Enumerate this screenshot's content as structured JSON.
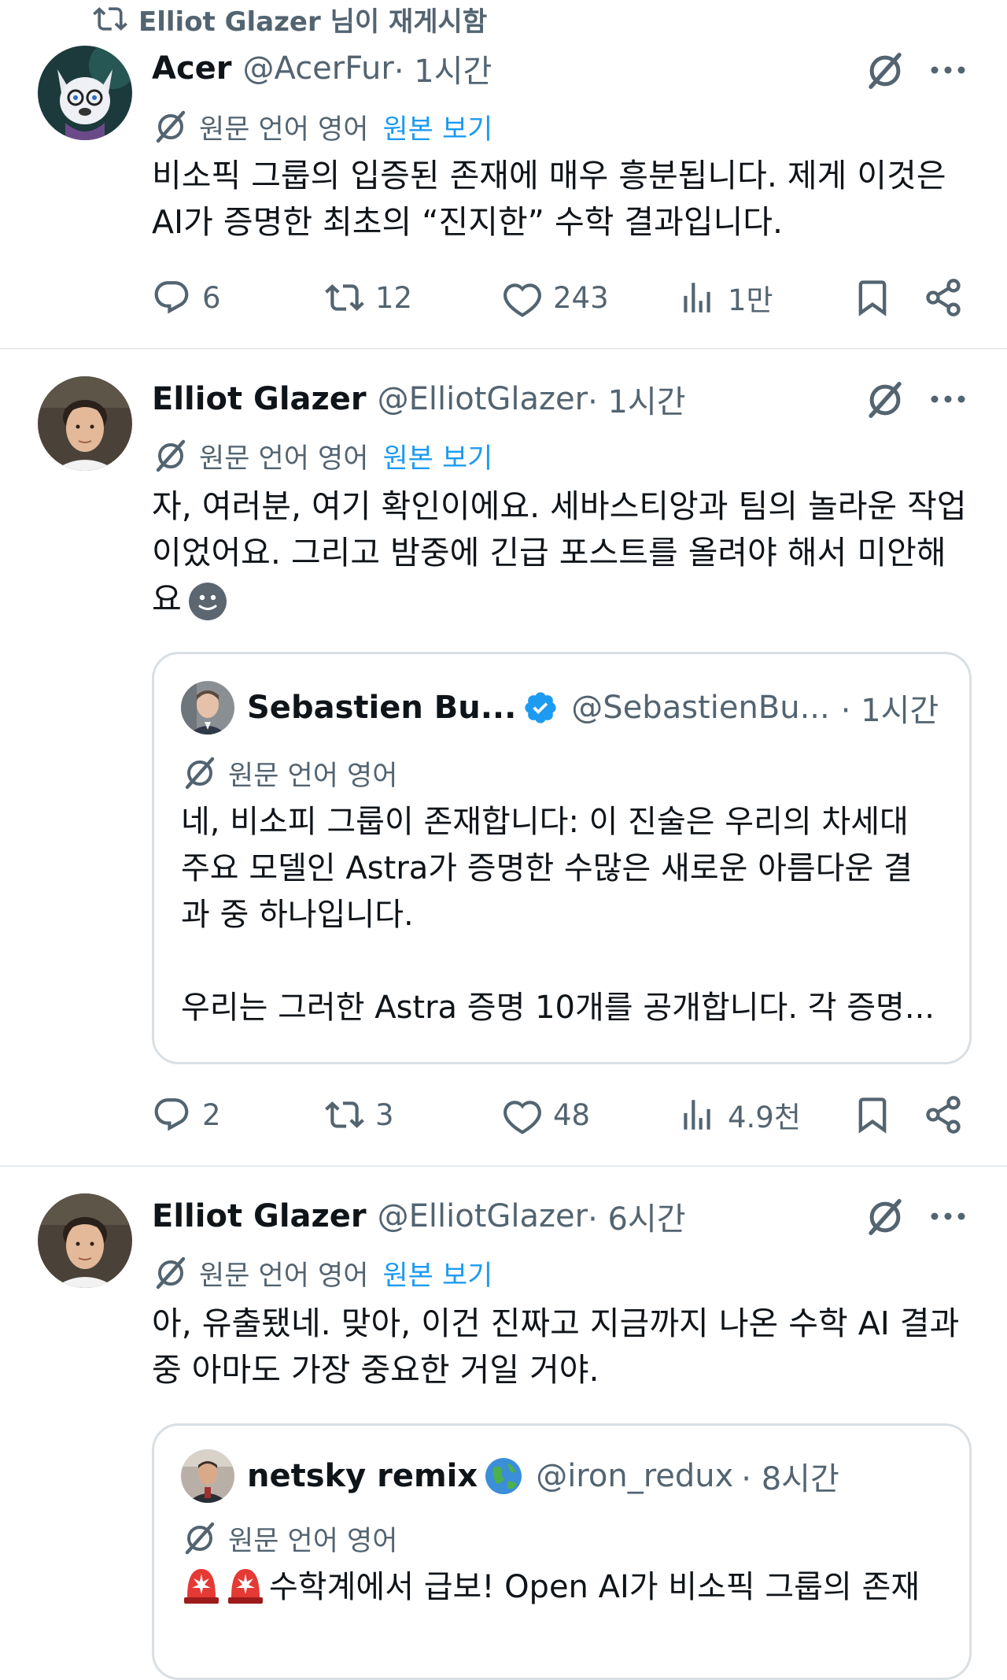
{
  "repost_banner": {
    "text": "Elliot Glazer 님이 재게시함"
  },
  "posts": [
    {
      "name": "Acer",
      "handle": "@AcerFur",
      "time": " · 1시간",
      "translation_label": "원문 언어 영어",
      "view_original": "원본 보기",
      "body_lines": [
        "비소픽 그룹의 입증된 존재에 매우 흥분됩니다. 제게 이것은",
        "AI가 증명한 최초의 “진지한” 수학 결과입니다."
      ],
      "replies": "6",
      "reposts": "12",
      "likes": "243",
      "views": "1만"
    },
    {
      "name": "Elliot Glazer",
      "handle": "@ElliotGlazer",
      "time": " · 1시간",
      "translation_label": "원문 언어 영어",
      "view_original": "원본 보기",
      "body_lines": [
        "자, 여러분, 여기 확인이에요. 세바스티앙과 팀의 놀라운 작업",
        "이었어요. 그리고 밤중에 긴급 포스트를 올려야 해서 미안해",
        "요"
      ],
      "quote": {
        "name": "Sebastien Bu...",
        "handle": "@SebastienBu...",
        "time": " · 1시간",
        "translation_label": "원문 언어 영어",
        "lines": [
          "네, 비소피 그룹이 존재합니다: 이 진술은 우리의 차세대",
          "주요 모델인 Astra가 증명한 수많은 새로운 아름다운 결",
          "과 중 하나입니다.",
          "우리는 그러한 Astra 증명 10개를 공개합니다. 각 증명..."
        ]
      },
      "replies": "2",
      "reposts": "3",
      "likes": "48",
      "views": "4.9천"
    },
    {
      "name": "Elliot Glazer",
      "handle": "@ElliotGlazer",
      "time": " · 6시간",
      "translation_label": "원문 언어 영어",
      "view_original": "원본 보기",
      "body_lines": [
        "아, 유출됐네. 맞아, 이건 진짜고 지금까지 나온 수학 AI 결과",
        "중 아마도 가장 중요한 거일 거야."
      ],
      "quote": {
        "name": "netsky remix",
        "handle": "@iron_redux",
        "time": " · 8시간",
        "translation_label": "원문 언어 영어",
        "lines": [
          "수학계에서 급보! Open AI가 비소픽 그룹의 존재"
        ]
      }
    }
  ],
  "colors": {
    "accent": "#1d9bf0",
    "muted": "#536471",
    "text": "#0f1419",
    "border": "#d9dfe3"
  },
  "icons": [
    "repost-icon",
    "grok-translate-icon",
    "more-icon",
    "reply-icon",
    "like-icon",
    "views-icon",
    "bookmark-icon",
    "share-icon",
    "verified-icon",
    "globe-emoji",
    "siren-emoji",
    "slight-smile-emoji"
  ]
}
